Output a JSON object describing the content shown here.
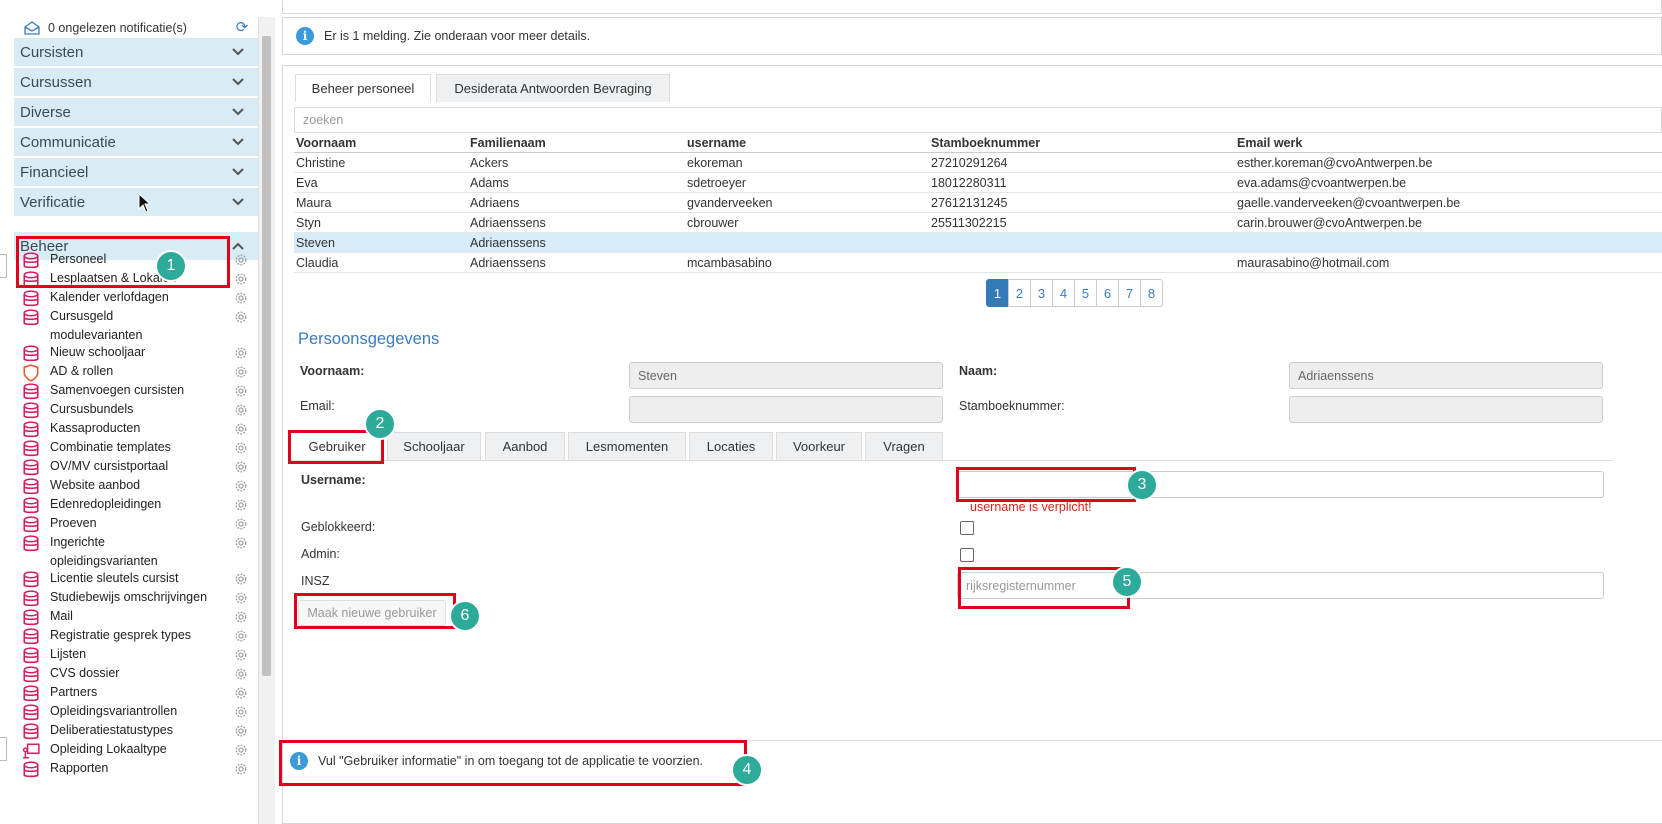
{
  "notifications": {
    "text": "0 ongelezen notificatie(s)"
  },
  "sidebar": {
    "sections": [
      {
        "label": "Cursisten"
      },
      {
        "label": "Cursussen"
      },
      {
        "label": "Diverse"
      },
      {
        "label": "Communicatie"
      },
      {
        "label": "Financieel"
      },
      {
        "label": "Verificatie"
      },
      {
        "label": "Beheer"
      }
    ],
    "items": [
      {
        "label": "Personeel"
      },
      {
        "label": "Lesplaatsen & Lokalen"
      },
      {
        "label": "Kalender verlofdagen"
      },
      {
        "label": "Cursusgeld",
        "label2": "modulevarianten"
      },
      {
        "label": "Nieuw schooljaar"
      },
      {
        "label": "AD & rollen"
      },
      {
        "label": "Samenvoegen cursisten"
      },
      {
        "label": "Cursusbundels"
      },
      {
        "label": "Kassaproducten"
      },
      {
        "label": "Combinatie templates"
      },
      {
        "label": "OV/MV cursistportaal"
      },
      {
        "label": "Website aanbod"
      },
      {
        "label": "Edenredopleidingen"
      },
      {
        "label": "Proeven"
      },
      {
        "label": "Ingerichte",
        "label2": "opleidingsvarianten"
      },
      {
        "label": "Licentie sleutels cursist"
      },
      {
        "label": "Studiebewijs omschrijvingen"
      },
      {
        "label": "Mail"
      },
      {
        "label": "Registratie gesprek types"
      },
      {
        "label": "Lijsten"
      },
      {
        "label": "CVS dossier"
      },
      {
        "label": "Partners"
      },
      {
        "label": "Opleidingsvariantrollen"
      },
      {
        "label": "Deliberatiestatustypes"
      },
      {
        "label": "Opleiding Lokaaltype"
      },
      {
        "label": "Rapporten"
      }
    ]
  },
  "message_top": "Er is 1 melding. Zie onderaan voor meer details.",
  "tabs": [
    {
      "label": "Beheer personeel"
    },
    {
      "label": "Desiderata Antwoorden Bevraging"
    }
  ],
  "search": {
    "placeholder": "zoeken"
  },
  "table": {
    "headers": [
      "Voornaam",
      "Familienaam",
      "username",
      "Stamboeknummer",
      "Email werk"
    ],
    "rows": [
      [
        "Christine",
        "Ackers",
        "ekoreman",
        "27210291264",
        "esther.koreman@cvoAntwerpen.be"
      ],
      [
        "Eva",
        "Adams",
        "sdetroeyer",
        "18012280311",
        "eva.adams@cvoantwerpen.be"
      ],
      [
        "Maura",
        "Adriaens",
        "gvanderveeken",
        "27612131245",
        "gaelle.vanderveeken@cvoantwerpen.be"
      ],
      [
        "Styn",
        "Adriaenssens",
        "cbrouwer",
        "25511302215",
        "carin.brouwer@cvoAntwerpen.be"
      ],
      [
        "Steven",
        "Adriaenssens",
        "",
        "",
        ""
      ],
      [
        "Claudia",
        "Adriaenssens",
        "mcambasabino",
        "",
        "maurasabino@hotmail.com"
      ]
    ]
  },
  "pagination": {
    "pages": [
      "1",
      "2",
      "3",
      "4",
      "5",
      "6",
      "7",
      "8"
    ],
    "active": "1"
  },
  "person": {
    "title": "Persoonsgegevens",
    "voornaam_label": "Voornaam:",
    "voornaam_value": "Steven",
    "naam_label": "Naam:",
    "naam_value": "Adriaenssens",
    "email_label": "Email:",
    "email_value": "",
    "stamboek_label": "Stamboeknummer:",
    "stamboek_value": ""
  },
  "subtabs": [
    {
      "label": "Gebruiker"
    },
    {
      "label": "Schooljaar"
    },
    {
      "label": "Aanbod"
    },
    {
      "label": "Lesmomenten"
    },
    {
      "label": "Locaties"
    },
    {
      "label": "Voorkeur"
    },
    {
      "label": "Vragen"
    }
  ],
  "user": {
    "username_label": "Username:",
    "username_value": "",
    "username_error": "username is verplicht!",
    "geblokkeerd_label": "Geblokkeerd:",
    "admin_label": "Admin:",
    "insz_label": "INSZ",
    "insz_placeholder": "rijksregisternummer",
    "create_button": "Maak nieuwe gebruiker"
  },
  "message_bottom": "Vul \"Gebruiker informatie\" in om toegang tot de applicatie te voorzien.",
  "annotations": [
    "1",
    "2",
    "3",
    "4",
    "5",
    "6"
  ],
  "colors": {
    "accent": "#337ab7",
    "section_bg": "#d9ebf5",
    "highlight": "#e0001b",
    "badge": "#2eaa9a",
    "error": "#d9261c",
    "db_icon": "#d81b60"
  }
}
